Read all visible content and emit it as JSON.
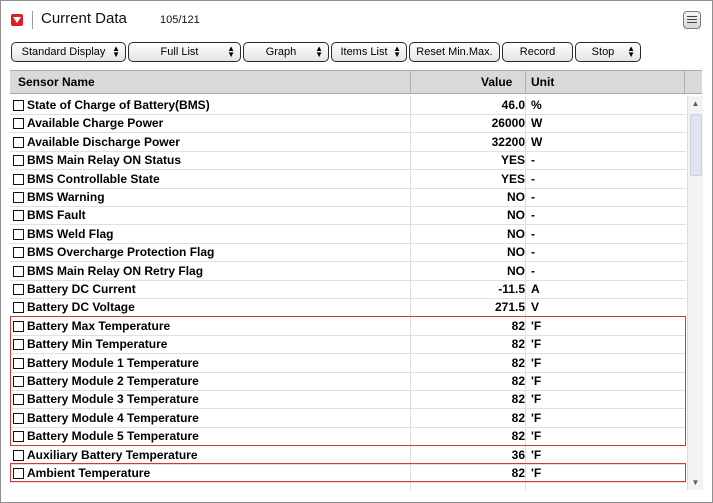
{
  "window": {
    "title": "Current Data",
    "count": "105/121"
  },
  "toolbar": {
    "standard_display": "Standard Display",
    "full_list": "Full List",
    "graph": "Graph",
    "items_list": "Items List",
    "reset_min_max": "Reset Min.Max.",
    "record": "Record",
    "stop": "Stop"
  },
  "table": {
    "headers": {
      "name": "Sensor Name",
      "value": "Value",
      "unit": "Unit"
    },
    "rows": [
      {
        "name": "State of Charge of Battery(BMS)",
        "value": "46.0",
        "unit": "%"
      },
      {
        "name": "Available Charge Power",
        "value": "26000",
        "unit": "W"
      },
      {
        "name": "Available Discharge Power",
        "value": "32200",
        "unit": "W"
      },
      {
        "name": "BMS Main Relay ON Status",
        "value": "YES",
        "unit": "-"
      },
      {
        "name": "BMS Controllable State",
        "value": "YES",
        "unit": "-"
      },
      {
        "name": "BMS Warning",
        "value": "NO",
        "unit": "-"
      },
      {
        "name": "BMS Fault",
        "value": "NO",
        "unit": "-"
      },
      {
        "name": "BMS Weld Flag",
        "value": "NO",
        "unit": "-"
      },
      {
        "name": "BMS Overcharge Protection Flag",
        "value": "NO",
        "unit": "-"
      },
      {
        "name": "BMS Main Relay ON Retry Flag",
        "value": "NO",
        "unit": "-"
      },
      {
        "name": "Battery DC Current",
        "value": "-11.5",
        "unit": "A"
      },
      {
        "name": "Battery DC Voltage",
        "value": "271.5",
        "unit": "V"
      },
      {
        "name": "Battery Max Temperature",
        "value": "82",
        "unit": "'F"
      },
      {
        "name": "Battery Min Temperature",
        "value": "82",
        "unit": "'F"
      },
      {
        "name": "Battery Module 1 Temperature",
        "value": "82",
        "unit": "'F"
      },
      {
        "name": "Battery Module 2 Temperature",
        "value": "82",
        "unit": "'F"
      },
      {
        "name": "Battery Module 3 Temperature",
        "value": "82",
        "unit": "'F"
      },
      {
        "name": "Battery Module 4 Temperature",
        "value": "82",
        "unit": "'F"
      },
      {
        "name": "Battery Module 5 Temperature",
        "value": "82",
        "unit": "'F"
      },
      {
        "name": "Auxiliary Battery Temperature",
        "value": "36",
        "unit": "'F"
      },
      {
        "name": "Ambient Temperature",
        "value": "82",
        "unit": "'F"
      }
    ]
  },
  "icons": {
    "title_icon": "dropdown-arrow-icon",
    "menu_icon": "menu-icon",
    "checkbox": "checkbox-icon",
    "scroll_up": "scroll-up-icon",
    "scroll_down": "scroll-down-icon"
  },
  "colors": {
    "accent": "#d8202a",
    "highlight_border": "#d23a3a",
    "header_bg": "#d9d9d9"
  }
}
